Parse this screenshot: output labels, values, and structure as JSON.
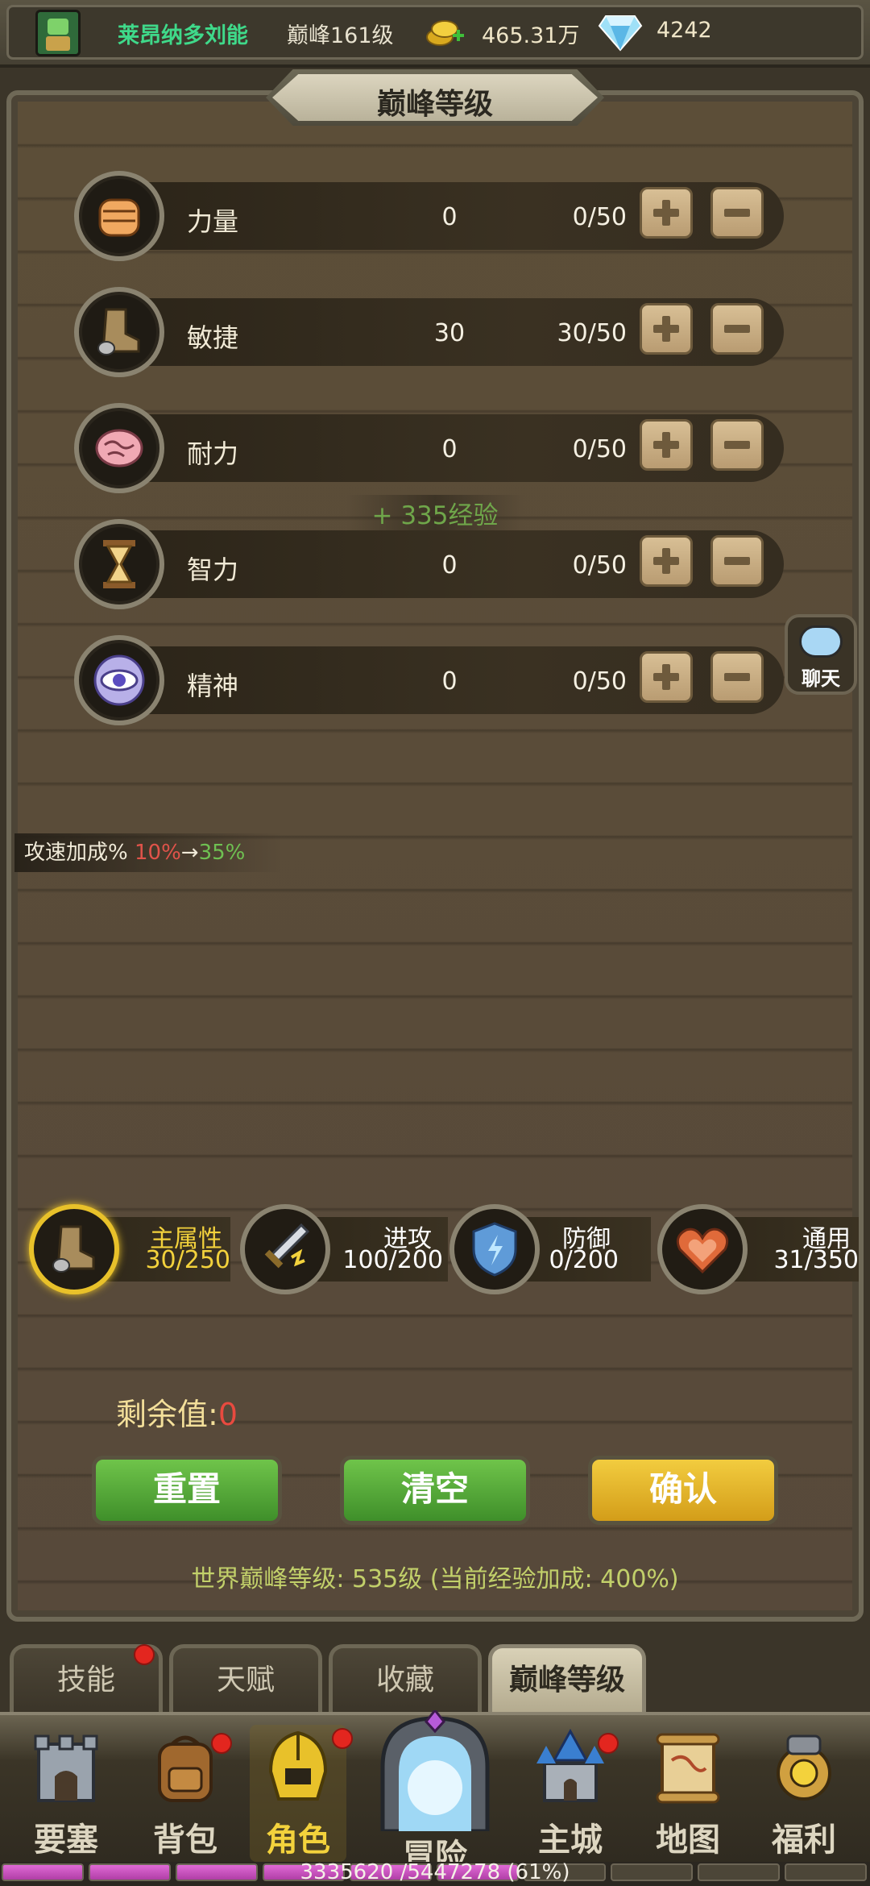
{
  "header": {
    "player_name": "莱昂纳多刘能",
    "level": "巅峰161级",
    "gold": "465.31万",
    "diamonds": "4242",
    "icons": [
      "avatar-icon",
      "gold-coin-icon",
      "diamond-icon"
    ]
  },
  "panel": {
    "title": "巅峰等级"
  },
  "attributes": [
    {
      "name": "力量",
      "value": "0",
      "progress": "0/50",
      "icon": "fist-icon"
    },
    {
      "name": "敏捷",
      "value": "30",
      "progress": "30/50",
      "icon": "boot-icon"
    },
    {
      "name": "耐力",
      "value": "0",
      "progress": "0/50",
      "icon": "brain-icon"
    },
    {
      "name": "智力",
      "value": "0",
      "progress": "0/50",
      "icon": "hourglass-icon"
    },
    {
      "name": "精神",
      "value": "0",
      "progress": "0/50",
      "icon": "eye-icon"
    }
  ],
  "exp_float": "+ 335经验",
  "chat_label": "聊天",
  "bonus": {
    "label": "攻速加成%",
    "old": "10%",
    "arrow": "→",
    "new": "35%"
  },
  "categories": [
    {
      "name": "主属性",
      "count": "30/250",
      "icon": "boot-icon",
      "active": true
    },
    {
      "name": "进攻",
      "count": "100/200",
      "icon": "sword-icon",
      "active": false
    },
    {
      "name": "防御",
      "count": "0/200",
      "icon": "shield-icon",
      "active": false
    },
    {
      "name": "通用",
      "count": "31/350",
      "icon": "heart-icon",
      "active": false
    }
  ],
  "remain": {
    "label": "剩余值:",
    "value": "0"
  },
  "actions": {
    "reset": "重置",
    "clear": "清空",
    "confirm": "确认"
  },
  "world_info": "世界巅峰等级: 535级 (当前经验加成: 400%)",
  "tabs": [
    {
      "label": "技能",
      "badge": true
    },
    {
      "label": "天赋",
      "badge": false
    },
    {
      "label": "收藏",
      "badge": false
    },
    {
      "label": "巅峰等级",
      "badge": false,
      "active": true
    }
  ],
  "nav": [
    {
      "label": "要塞",
      "icon": "fortress-icon",
      "badge": false
    },
    {
      "label": "背包",
      "icon": "backpack-icon",
      "badge": true
    },
    {
      "label": "角色",
      "icon": "helmet-icon",
      "badge": true,
      "active": true
    },
    {
      "label": "冒险",
      "icon": "portal-icon",
      "badge": false
    },
    {
      "label": "主城",
      "icon": "castle-icon",
      "badge": true
    },
    {
      "label": "地图",
      "icon": "map-scroll-icon",
      "badge": false
    },
    {
      "label": "福利",
      "icon": "gift-bag-icon",
      "badge": false
    }
  ],
  "exp_bar": {
    "text": "3335620 /5447278 (61%)",
    "fraction": 0.61
  },
  "colors": {
    "name_green": "#3fd98a",
    "accent_yellow": "#f3d23c",
    "button_green": "#4fa535",
    "button_yellow": "#e3b32a",
    "badge_red": "#e3261f",
    "exp_pink": "#c94fbf"
  }
}
